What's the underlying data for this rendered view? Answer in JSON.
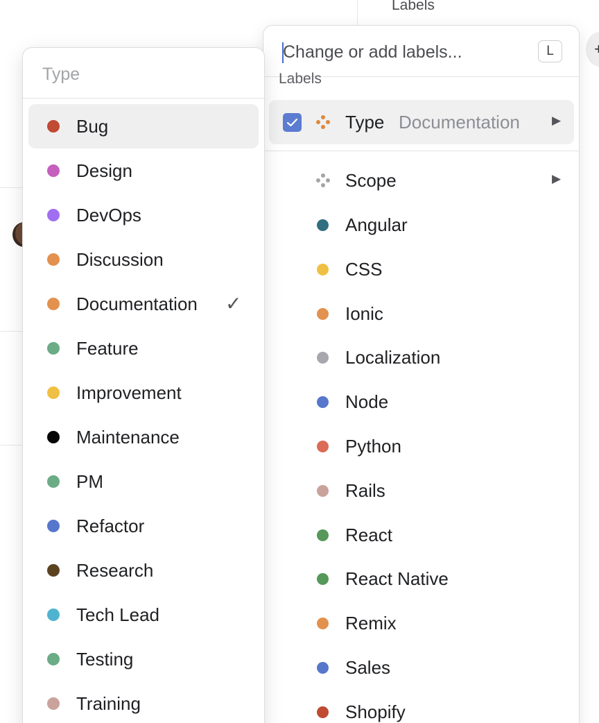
{
  "background": {
    "heading": "Labels",
    "round_button_glyph": "+"
  },
  "labels_menu": {
    "search_placeholder": "Change or add labels...",
    "shortcut_key": "L",
    "section_title": "Labels",
    "selected_group": {
      "label": "Type",
      "value": "Documentation",
      "checked": true,
      "icon": "label-group-icon",
      "icon_color": "#e0883c"
    },
    "scope_group": {
      "label": "Scope",
      "icon": "label-group-icon",
      "icon_color": "#a3a4a8"
    },
    "items": [
      {
        "label": "Angular",
        "color": "#2f6f80"
      },
      {
        "label": "CSS",
        "color": "#f0c044"
      },
      {
        "label": "Ionic",
        "color": "#e3914e"
      },
      {
        "label": "Localization",
        "color": "#a7a7ad"
      },
      {
        "label": "Node",
        "color": "#5677cc"
      },
      {
        "label": "Python",
        "color": "#dc6a58"
      },
      {
        "label": "Rails",
        "color": "#c9a39b"
      },
      {
        "label": "React",
        "color": "#55985a"
      },
      {
        "label": "React Native",
        "color": "#55985a"
      },
      {
        "label": "Remix",
        "color": "#e3914e"
      },
      {
        "label": "Sales",
        "color": "#5677cc"
      },
      {
        "label": "Shopify",
        "color": "#c04a32"
      }
    ]
  },
  "type_submenu": {
    "search_placeholder": "Type",
    "items": [
      {
        "label": "Bug",
        "color": "#c04a32",
        "active": true
      },
      {
        "label": "Design",
        "color": "#c560be"
      },
      {
        "label": "DevOps",
        "color": "#a06ff0"
      },
      {
        "label": "Discussion",
        "color": "#e3914e"
      },
      {
        "label": "Documentation",
        "color": "#e3914e",
        "checked": true
      },
      {
        "label": "Feature",
        "color": "#6bab86"
      },
      {
        "label": "Improvement",
        "color": "#f0c044"
      },
      {
        "label": "Maintenance",
        "color": "#050505"
      },
      {
        "label": "PM",
        "color": "#6bab86"
      },
      {
        "label": "Refactor",
        "color": "#5677cc"
      },
      {
        "label": "Research",
        "color": "#5b4322"
      },
      {
        "label": "Tech Lead",
        "color": "#4fb3cf"
      },
      {
        "label": "Testing",
        "color": "#6bab86"
      },
      {
        "label": "Training",
        "color": "#c9a39b"
      }
    ]
  }
}
